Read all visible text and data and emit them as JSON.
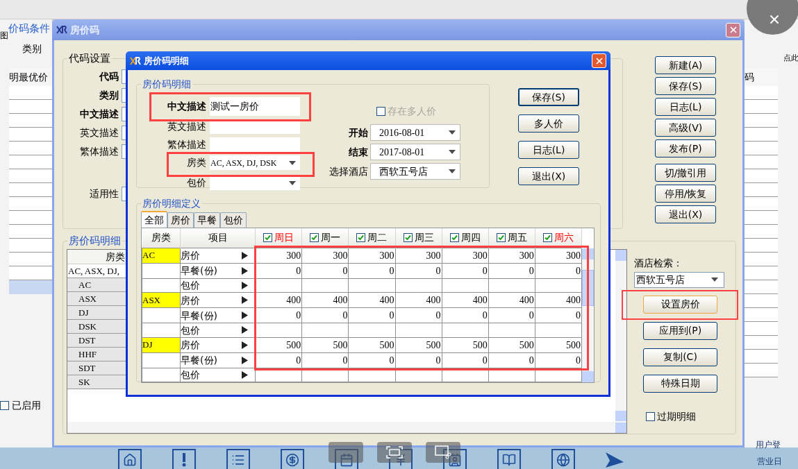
{
  "background_app": {
    "sidebar_title": "价码条件",
    "view_label": "图",
    "category_label": "类别",
    "column_header": "明最优价",
    "enabled": {
      "label": "已启用",
      "checked": false
    },
    "right_column_header": "码",
    "right_hint": "点此",
    "status_user": "用户登",
    "status_date": "营业日"
  },
  "main_window": {
    "title": "房价码",
    "code_group": {
      "legend": "代码设置",
      "labels": [
        {
          "text": "代码",
          "bold": true
        },
        {
          "text": "类别",
          "bold": true
        },
        {
          "text": "中文描述",
          "bold": true
        },
        {
          "text": "英文描述",
          "bold": false
        },
        {
          "text": "繁体描述",
          "bold": false
        },
        {
          "text": "适用性",
          "bold": false
        }
      ]
    },
    "buttons": [
      "新建(A)",
      "保存(S)",
      "日志(L)",
      "高级(V)",
      "发布(P)",
      "切/撤引用",
      "停用/恢复",
      "退出(X)"
    ],
    "detail_group": {
      "legend": "房价码明细",
      "column_header": "房类",
      "rows": [
        {
          "text": "AC, ASX, DJ,",
          "summary": true
        },
        {
          "text": "AC",
          "summary": false
        },
        {
          "text": "ASX",
          "summary": false
        },
        {
          "text": "DJ",
          "summary": false
        },
        {
          "text": "DSK",
          "summary": false
        },
        {
          "text": "DST",
          "summary": false
        },
        {
          "text": "HHF",
          "summary": false
        },
        {
          "text": "SDT",
          "summary": false
        },
        {
          "text": "SK",
          "summary": false
        }
      ]
    },
    "hotel_search": {
      "label": "酒店检索：",
      "value": "西软五号店",
      "buttons": [
        "设置房价",
        "应用到(P)",
        "复制(C)",
        "特殊日期"
      ],
      "expired": {
        "label": "过期明细",
        "checked": false
      }
    }
  },
  "dialog": {
    "title": "房价码明细",
    "info_group": {
      "legend": "房价码明细",
      "fields": [
        {
          "label": "中文描述",
          "bold": true,
          "kind": "text",
          "value": "测试一房价"
        },
        {
          "label": "英文描述",
          "bold": false,
          "kind": "text"
        },
        {
          "label": "繁体描述",
          "bold": false,
          "kind": "text"
        },
        {
          "label": "房类",
          "bold": false,
          "kind": "dropdown",
          "value": "AC, ASX, DJ, DSK"
        },
        {
          "label": "包价",
          "bold": false,
          "kind": "dropdown"
        }
      ],
      "multi_person": {
        "label": "存在多人价",
        "checked": false,
        "disabled": true
      },
      "right_fields": [
        {
          "label": "开始",
          "bold": true,
          "value": "2016-08-01"
        },
        {
          "label": "结束",
          "bold": true,
          "value": "2017-08-01"
        },
        {
          "label": "选择酒店",
          "bold": false,
          "value": "西软五号店"
        }
      ]
    },
    "buttons": [
      "保存(S)",
      "多人价",
      "日志(L)",
      "退出(X)"
    ],
    "definition_group": {
      "legend": "房价明细定义",
      "tabs": [
        {
          "label": "全部",
          "selected": true
        },
        {
          "label": "房价",
          "selected": false
        },
        {
          "label": "早餐",
          "selected": false
        },
        {
          "label": "包价",
          "selected": false
        }
      ],
      "columns": [
        "房类",
        "项目"
      ],
      "days": [
        {
          "label": "周日",
          "checked": true,
          "weekend": true
        },
        {
          "label": "周一",
          "checked": true,
          "weekend": false
        },
        {
          "label": "周二",
          "checked": true,
          "weekend": false
        },
        {
          "label": "周三",
          "checked": true,
          "weekend": false
        },
        {
          "label": "周四",
          "checked": true,
          "weekend": false
        },
        {
          "label": "周五",
          "checked": true,
          "weekend": false
        },
        {
          "label": "周六",
          "checked": true,
          "weekend": true
        }
      ],
      "groups": [
        {
          "room": "AC",
          "items": [
            {
              "item": "房价",
              "values": [
                "300",
                "300",
                "300",
                "300",
                "300",
                "300",
                "300"
              ]
            },
            {
              "item": "早餐(份)",
              "values": [
                "0",
                "0",
                "0",
                "0",
                "0",
                "0",
                "0"
              ]
            },
            {
              "item": "包价"
            }
          ]
        },
        {
          "room": "ASX",
          "items": [
            {
              "item": "房价",
              "values": [
                "400",
                "400",
                "400",
                "400",
                "400",
                "400",
                "400"
              ]
            },
            {
              "item": "早餐(份)",
              "values": [
                "0",
                "0",
                "0",
                "0",
                "0",
                "0",
                "0"
              ]
            },
            {
              "item": "包价"
            }
          ]
        },
        {
          "room": "DJ",
          "items": [
            {
              "item": "房价",
              "values": [
                "500",
                "500",
                "500",
                "500",
                "500",
                "500",
                "500"
              ]
            },
            {
              "item": "早餐(份)",
              "values": [
                "0",
                "0",
                "0",
                "0",
                "0",
                "0",
                "0"
              ]
            },
            {
              "item": "包价"
            }
          ]
        }
      ]
    }
  }
}
